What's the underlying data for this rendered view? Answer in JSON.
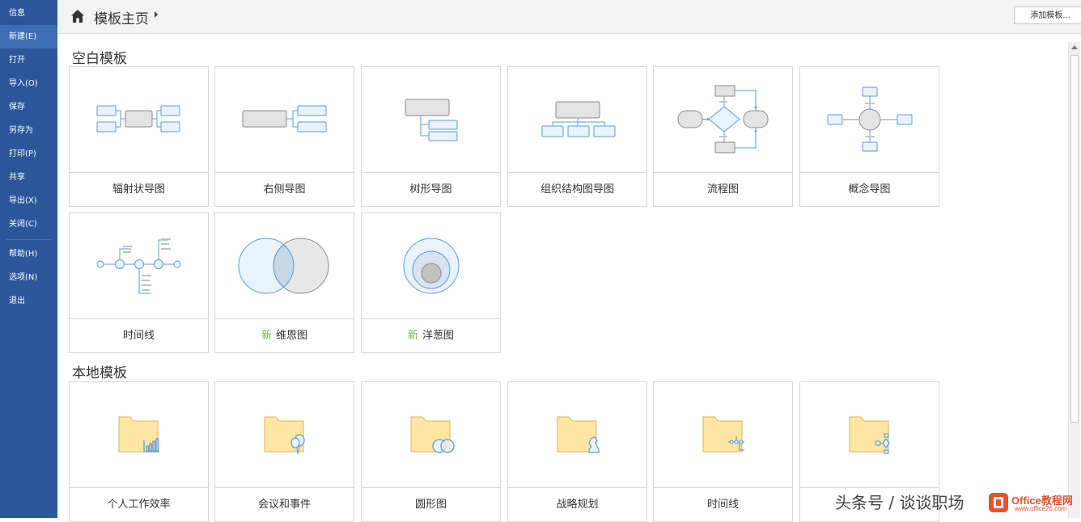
{
  "sidebar": {
    "items": [
      {
        "label": "信息"
      },
      {
        "label": "新建(E)"
      },
      {
        "label": "打开"
      },
      {
        "label": "导入(O)"
      },
      {
        "label": "保存"
      },
      {
        "label": "另存为"
      },
      {
        "label": "打印(P)"
      },
      {
        "label": "共享"
      },
      {
        "label": "导出(X)"
      },
      {
        "label": "关闭(C)"
      },
      {
        "label": "帮助(H)"
      },
      {
        "label": "选项(N)"
      },
      {
        "label": "退出"
      }
    ],
    "active_label": "新建(E)"
  },
  "header": {
    "title": "模板主页",
    "add_button_label": "添加模板..."
  },
  "blank_section": {
    "title": "空白模板",
    "new_tag": "新",
    "templates": [
      {
        "label": "辐射状导图",
        "icon": "radial-map-icon"
      },
      {
        "label": "右侧导图",
        "icon": "right-map-icon"
      },
      {
        "label": "树形导图",
        "icon": "tree-map-icon"
      },
      {
        "label": "组织结构图导图",
        "icon": "org-chart-icon"
      },
      {
        "label": "流程图",
        "icon": "flowchart-icon"
      },
      {
        "label": "概念导图",
        "icon": "concept-map-icon"
      },
      {
        "label": "时间线",
        "icon": "timeline-icon"
      },
      {
        "label": "维恩图",
        "icon": "venn-icon",
        "is_new": true
      },
      {
        "label": "洋葱图",
        "icon": "onion-icon",
        "is_new": true
      }
    ]
  },
  "local_section": {
    "title": "本地模板",
    "folders": [
      {
        "label": "个人工作效率",
        "icon": "folder-chart-icon"
      },
      {
        "label": "会议和事件",
        "icon": "folder-balloon-icon"
      },
      {
        "label": "圆形图",
        "icon": "folder-venn-icon"
      },
      {
        "label": "战略规划",
        "icon": "folder-chess-icon"
      },
      {
        "label": "时间线",
        "icon": "folder-timeline-icon"
      },
      {
        "label": "",
        "icon": "folder-flow-icon"
      }
    ]
  },
  "watermark": {
    "text": "头条号 / 谈谈职场",
    "logo_text": "Office教程网",
    "logo_sub": "www.office26.com"
  },
  "colors": {
    "sidebar": "#2b579a",
    "accent_new": "#78b446",
    "diagram_blue": "#5b9bd5",
    "folder": "#ffe7a3"
  }
}
